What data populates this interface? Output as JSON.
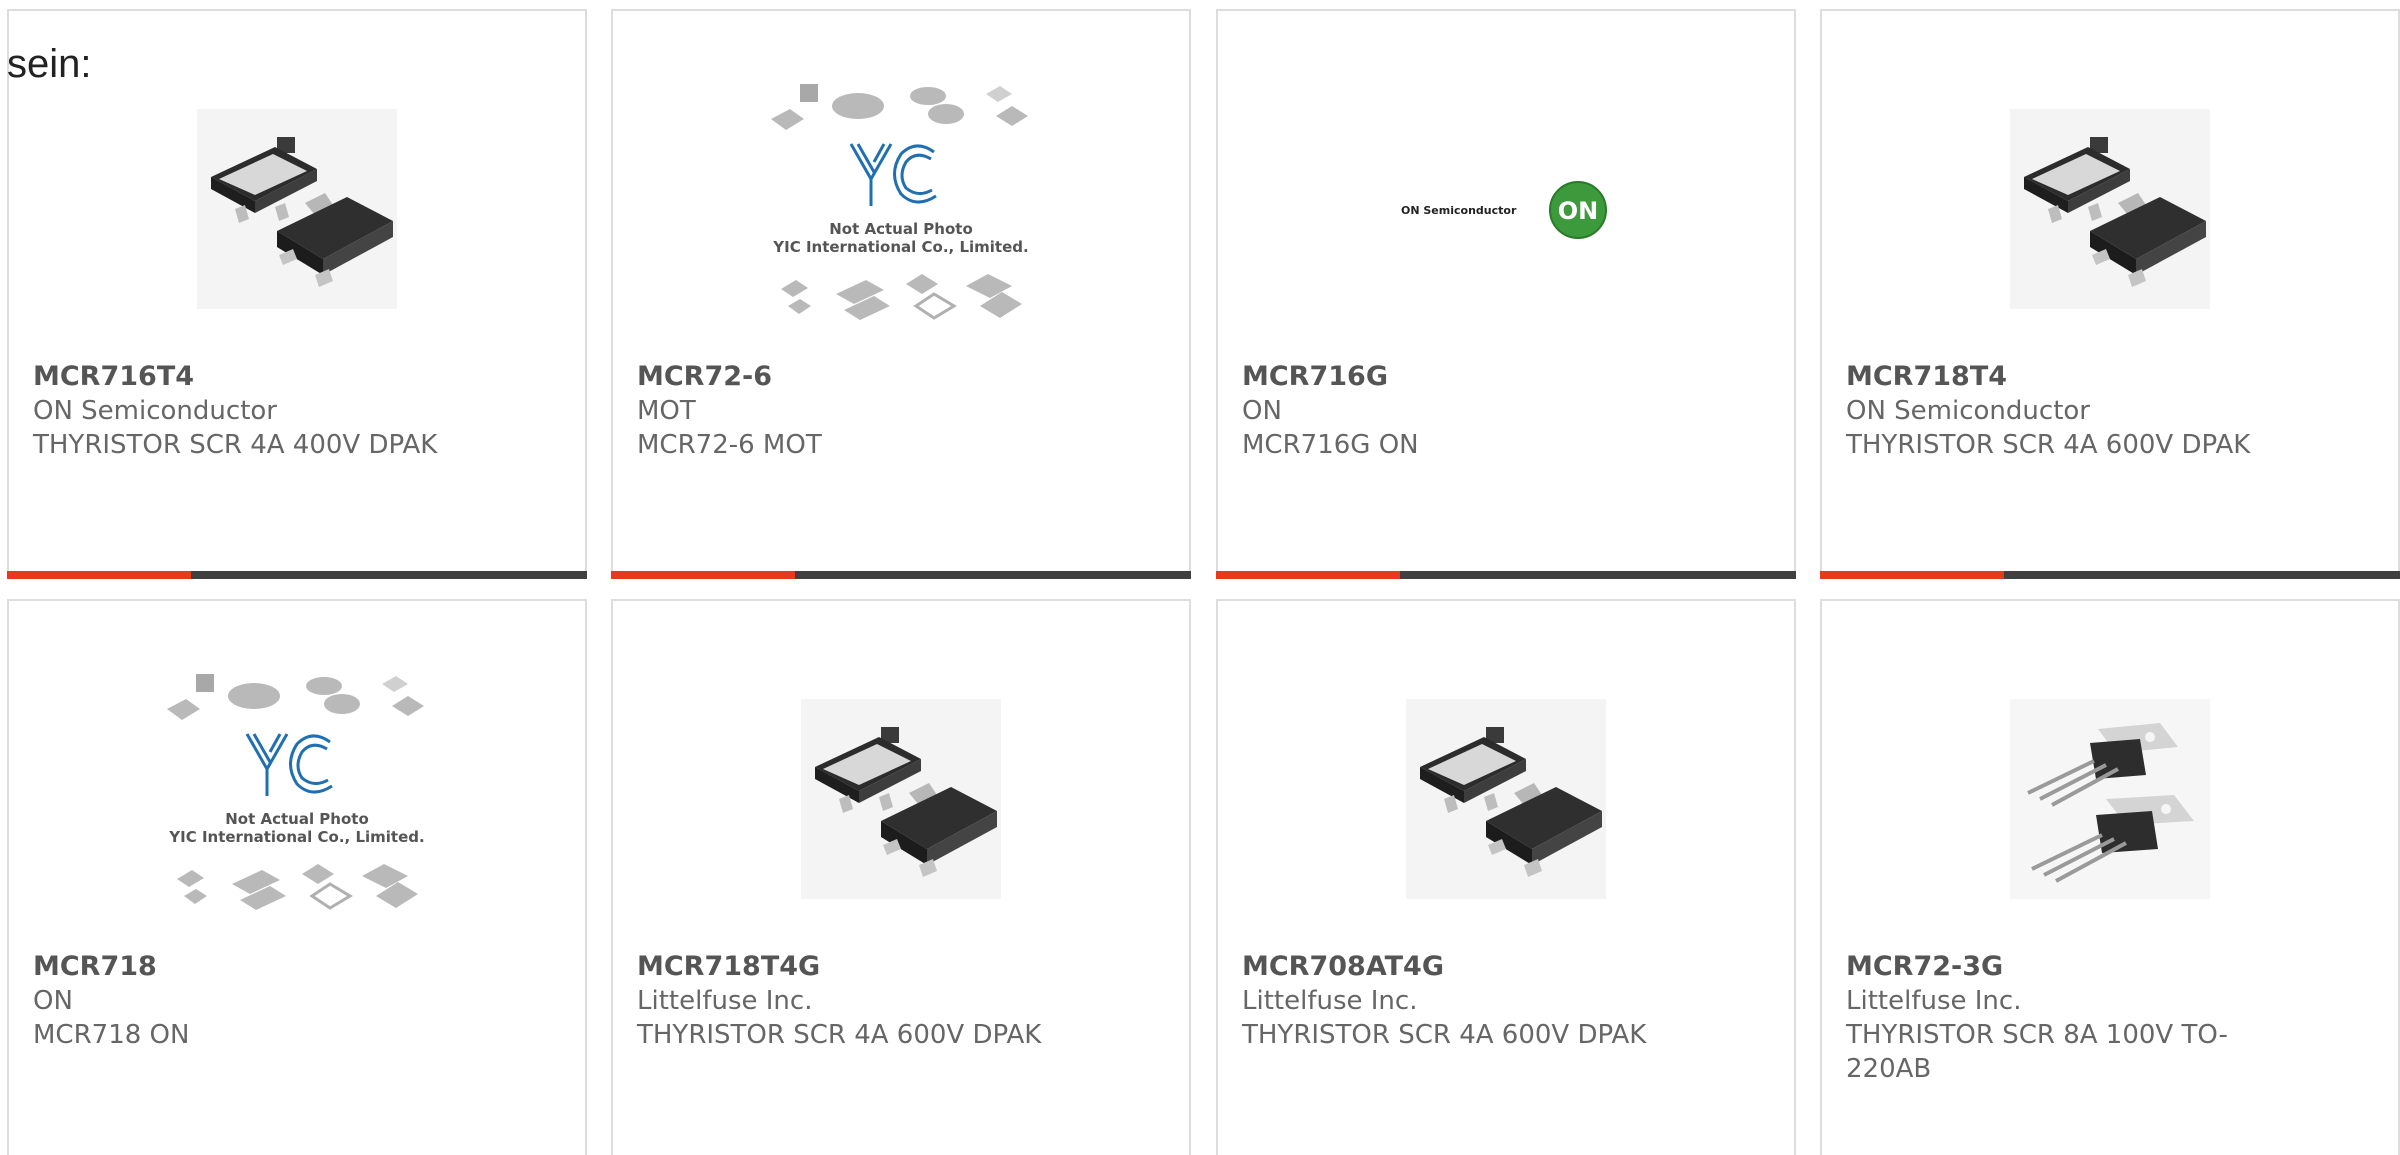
{
  "lead_text": "sein:",
  "products": [
    {
      "part": "MCR716T4",
      "manufacturer": "ON Semiconductor",
      "description": "THYRISTOR SCR 4A 400V DPAK",
      "image": "dpak-package-icon"
    },
    {
      "part": "MCR72-6",
      "manufacturer": "MOT",
      "description": "MCR72-6 MOT",
      "image": "yic-placeholder"
    },
    {
      "part": "MCR716G",
      "manufacturer": "ON",
      "description": "MCR716G ON",
      "image": "on-semiconductor-logo"
    },
    {
      "part": "MCR718T4",
      "manufacturer": "ON Semiconductor",
      "description": "THYRISTOR SCR 4A 600V DPAK",
      "image": "dpak-package-icon"
    },
    {
      "part": "MCR718",
      "manufacturer": "ON",
      "description": "MCR718 ON",
      "image": "yic-placeholder"
    },
    {
      "part": "MCR718T4G",
      "manufacturer": "Littelfuse Inc.",
      "description": "THYRISTOR SCR 4A 600V DPAK",
      "image": "dpak-package-icon"
    },
    {
      "part": "MCR708AT4G",
      "manufacturer": "Littelfuse Inc.",
      "description": "THYRISTOR SCR 4A 600V DPAK",
      "image": "dpak-package-icon"
    },
    {
      "part": "MCR72-3G",
      "manufacturer": "Littelfuse Inc.",
      "description": "THYRISTOR SCR 8A 100V TO-220AB",
      "image": "to220-package-icon"
    }
  ],
  "placeholder": {
    "brand": "YIC",
    "line1": "Not Actual Photo",
    "line2": "YIC International Co., Limited."
  },
  "on_logo": {
    "wordmark": "ON Semiconductor",
    "mark": "ON"
  },
  "colors": {
    "accent": "#e8391d",
    "bar": "#404040",
    "border": "#dddddd",
    "text": "#666666",
    "yic_blue": "#1f6fb2",
    "on_green": "#3c9a3c"
  }
}
